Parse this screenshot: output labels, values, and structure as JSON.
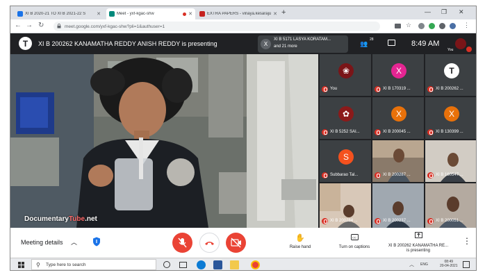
{
  "browser": {
    "tabs": [
      {
        "title": "XI B 2020-21 TO XI B 2021-22 S",
        "favicon_color": "#1a73e8"
      },
      {
        "title": "Meet - yxf-kgac-shw",
        "favicon_color": "#00897b"
      },
      {
        "title": "EXTRA PAPERS - vinaya.kesaraju",
        "favicon_color": "#c5221f"
      }
    ],
    "new_tab": "+",
    "window_controls": [
      "—",
      "❐",
      "✕"
    ],
    "url": "meet.google.com/yxf-kgac-shw?pli=1&authuser=1"
  },
  "meet": {
    "presenter_initial": "T",
    "presenting_banner": "XI B 200262 KANAMATHA REDDY ANISH REDDY is presenting",
    "notification": {
      "initial": "X",
      "line1": "XI B 5171 LASYA KORATAM...",
      "line2": "and 21 more"
    },
    "people_count": "28",
    "time": "8:49 AM",
    "self_label": "You",
    "watermark_main": "Documentary",
    "watermark_accent": "Tube",
    "watermark_tail": ".net"
  },
  "tiles": [
    {
      "name": "You",
      "type": "photo",
      "color": "#7a1518"
    },
    {
      "name": "XI B 170319 ...",
      "type": "initial",
      "initial": "X",
      "color": "#e52592"
    },
    {
      "name": "XI B 200262 ...",
      "type": "initial",
      "initial": "T",
      "color": "#ffffff"
    },
    {
      "name": "XI B 5252 SAI...",
      "type": "photo",
      "color": "#8b1a1a"
    },
    {
      "name": "XI B 200045 ...",
      "type": "initial",
      "initial": "X",
      "color": "#e8710a"
    },
    {
      "name": "XI B 130399 ...",
      "type": "initial",
      "initial": "X",
      "color": "#e8710a"
    },
    {
      "name": "Subbarao Tal...",
      "type": "initial",
      "initial": "S",
      "color": "#f4511e"
    },
    {
      "name": "XI B 200287 ...",
      "type": "camera",
      "color": "#8a7a6a"
    },
    {
      "name": "XI B 160547 ...",
      "type": "camera",
      "color": "#b8b0a6"
    },
    {
      "name": "XI B 200284 ...",
      "type": "camera",
      "color": "#b89a8a"
    },
    {
      "name": "XI B 200237 ...",
      "type": "camera",
      "color": "#9aa0a8"
    },
    {
      "name": "XI B 200051 ...",
      "type": "camera",
      "color": "#a89a90"
    }
  ],
  "controls": {
    "meeting_details": "Meeting details",
    "raise_hand": "Raise hand",
    "captions": "Turn on captions",
    "presenting_line1": "XI B 200262 KANAMATHA RE...",
    "presenting_line2": "is presenting",
    "more": "⋮"
  },
  "taskbar": {
    "search_placeholder": "Type here to search",
    "lang": "ENG",
    "time": "08:49",
    "date": "20-04-2021"
  },
  "colors": {
    "meet_bg": "#202124",
    "tile_bg": "#3c4043",
    "danger_red": "#ea4335"
  }
}
